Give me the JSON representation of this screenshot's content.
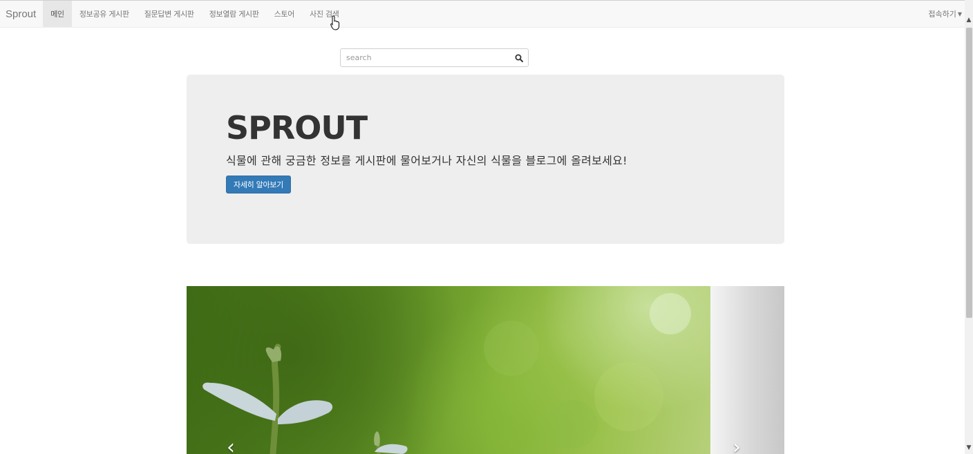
{
  "navbar": {
    "brand": "Sprout",
    "items": [
      {
        "label": "메인",
        "active": true
      },
      {
        "label": "정보공유 게시판",
        "active": false
      },
      {
        "label": "질문답변 게시판",
        "active": false
      },
      {
        "label": "정보열람 게시판",
        "active": false
      },
      {
        "label": "스토어",
        "active": false
      },
      {
        "label": "사진 검색",
        "active": false
      }
    ],
    "right_label": "접속하기",
    "right_icon": "caret-down-icon"
  },
  "search": {
    "placeholder": "search",
    "value": "",
    "icon": "search-icon"
  },
  "jumbotron": {
    "title": "SPROUT",
    "text": "식물에 관해 궁금한 정보를 게시판에 물어보거나 자신의 식물을 블로그에 올려보세요!",
    "button_label": "자세히 알아보기",
    "button_color": "#337ab7"
  },
  "carousel": {
    "prev_icon": "chevron-left-icon",
    "next_icon": "chevron-right-icon",
    "prev_glyph": "‹",
    "next_glyph": "›"
  },
  "colors": {
    "navbar_bg": "#f8f8f8",
    "jumbotron_bg": "#eeeeee",
    "primary": "#337ab7"
  }
}
